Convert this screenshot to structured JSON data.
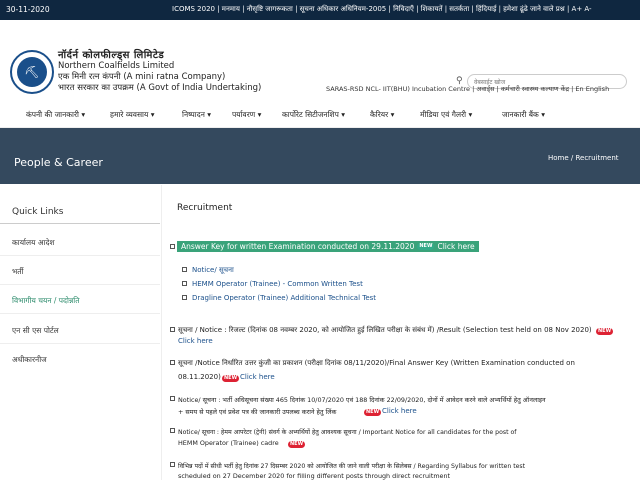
{
  "topbar": {
    "date": "30-11-2020",
    "links": "ICOMS 2020 | मनमाय | नौसृष्टि जागरूकता | सूचना अधिकार अधिनियम-2005 | निविदाएँ | शिकायतें | सतर्कता | हिंदियाई | हमेशा ढूंढे जाने वाले प्रश्न | A+ A-",
    "new_label": "NEW"
  },
  "header": {
    "brand_hi": "नॉर्दर्न कोलफील्ड्स लिमिटेड",
    "brand_en": "Northern Coalfields Limited",
    "tagline_1": "एक मिनी रत्न कंपनी (A mini ratna Company)",
    "tagline_2": "भारत सरकार का उपक्रम (A Govt of India Undertaking)",
    "search_placeholder": "वेबसाईट खोज",
    "subheader": "SARAS-RSD  NCL- IIT(BHU) Incubation Centre | अवार्ड्स | कर्मचारी स्वास्थ्य कल्याण केंद्र | En English"
  },
  "nav": {
    "items": [
      "कंपनी की जानकारी ▾",
      "हमारे व्यवसाय ▾",
      "निष्पादन ▾",
      "पर्यावरण ▾",
      "कार्पोरेट सिटीजनशिप ▾",
      "कैरियर ▾",
      "मीडिया एवं गैलरी ▾",
      "जानकारी बैंक ▾"
    ]
  },
  "banner": {
    "title": "People & Career",
    "breadcrumb": "Home  /  Recruitment"
  },
  "sidebar": {
    "title": "Quick Links",
    "items": [
      "कार्यालय आदेश",
      "भर्ती",
      "विभागीय चयन / पदोन्नति",
      "एन सी एस पोर्टल",
      "अधीकारनीज"
    ]
  },
  "main": {
    "heading": "Recruitment",
    "highlight": "Answer Key for written Examination conducted on 29.11.2020",
    "highlight_link": "Click here",
    "sub_items": [
      "Notice/ सूचना",
      "HEMM Operator (Trainee) - Common Written Test",
      "Dragline Operator (Trainee) Additional Technical Test"
    ],
    "notices": [
      {
        "text": "सूचना / Notice : रिजल्ट (दिनांक 08 नवम्बर 2020, को आयोजित हुई लिखित परीक्षा के संबंध में) /Result  (Selection test held on 08 Nov 2020)",
        "link": "Click here"
      },
      {
        "text": "सूचना /Notice  निर्धारित उत्तर कुंजी का प्रकाशन (परीक्षा दिनांक 08/11/2020)/Final Answer Key (Written Examination conducted on",
        "line2": "08.11.2020)",
        "link": "Click here"
      },
      {
        "text": "Notice/ सूचना : भर्ती अधिसूचना संख्या 465 दिनांक 10/07/2020 एवं 188 दिनांक 22/09/2020, दोनों में आवेदन करने वाले अभ्यर्थियों हेतु ऑनलाइन",
        "line2": "+ समय से पहले एवं प्रवेश पत्र की जानकारी उपलब्ध कराने हेतु लिंक",
        "link": "Click here"
      },
      {
        "text": "Notice/ सूचना : हेमम आपरेटर (ट्रेनी) संवर्ग के अभ्यर्थियों हेतु आवश्यक सूचना / Important Notice for all candidates for the post of",
        "line2": "HEMM Operator (Trainee) cadre",
        "link": ""
      },
      {
        "text": "विभिन्न पदों में सीधी भर्ती हेतु दिनांक 27 दिसम्बर 2020 को आयोजित की जाने वाली परीक्षा के सिलेबस / Regarding Syllabus for written test",
        "line2": "scheduled on 27 December 2020 for filling different posts through direct recruitment",
        "link": ""
      }
    ]
  }
}
